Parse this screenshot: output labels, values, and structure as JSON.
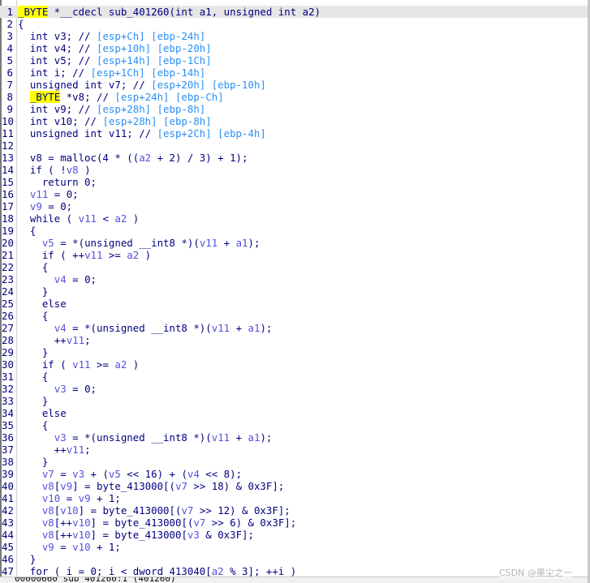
{
  "code_lines": [
    "<span class=\"hl\">_BYTE</span> *__cdecl sub_401260(int a1, unsigned int a2)",
    "{",
    "  int v3; // <span class=\"cm\">[esp+Ch] [ebp-24h]</span>",
    "  int v4; // <span class=\"cm\">[esp+10h] [ebp-20h]</span>",
    "  int v5; // <span class=\"cm\">[esp+14h] [ebp-1Ch]</span>",
    "  int i; // <span class=\"cm\">[esp+1Ch] [ebp-14h]</span>",
    "  unsigned int v7; // <span class=\"cm\">[esp+20h] [ebp-10h]</span>",
    "  <span class=\"hl\">_BYTE</span> *v8; // <span class=\"cm\">[esp+24h] [ebp-Ch]</span>",
    "  int v9; // <span class=\"cm\">[esp+28h] [ebp-8h]</span>",
    "  int v10; // <span class=\"cm\">[esp+28h] [ebp-8h]</span>",
    "  unsigned int v11; // <span class=\"cm\">[esp+2Ch] [ebp-4h]</span>",
    "",
    "  v8 = malloc(4 * ((<span class=\"var\">a2</span> + 2) / 3) + 1);",
    "  if ( !<span class=\"var\">v8</span> )",
    "    return 0;",
    "  <span class=\"var\">v11</span> = 0;",
    "  <span class=\"var\">v9</span> = 0;",
    "  while ( <span class=\"var\">v11</span> &lt; <span class=\"var\">a2</span> )",
    "  {",
    "    <span class=\"var\">v5</span> = *(unsigned __int8 *)(<span class=\"var\">v11</span> + <span class=\"var\">a1</span>);",
    "    if ( ++<span class=\"var\">v11</span> &gt;= <span class=\"var\">a2</span> )",
    "    {",
    "      <span class=\"var\">v4</span> = 0;",
    "    }",
    "    else",
    "    {",
    "      <span class=\"var\">v4</span> = *(unsigned __int8 *)(<span class=\"var\">v11</span> + <span class=\"var\">a1</span>);",
    "      ++<span class=\"var\">v11</span>;",
    "    }",
    "    if ( <span class=\"var\">v11</span> &gt;= <span class=\"var\">a2</span> )",
    "    {",
    "      <span class=\"var\">v3</span> = 0;",
    "    }",
    "    else",
    "    {",
    "      <span class=\"var\">v3</span> = *(unsigned __int8 *)(<span class=\"var\">v11</span> + <span class=\"var\">a1</span>);",
    "      ++<span class=\"var\">v11</span>;",
    "    }",
    "    <span class=\"var\">v7</span> = <span class=\"var\">v3</span> + (<span class=\"var\">v5</span> &lt;&lt; 16) + (<span class=\"var\">v4</span> &lt;&lt; 8);",
    "    <span class=\"var\">v8</span>[<span class=\"var\">v9</span>] = byte_413000[(<span class=\"var\">v7</span> &gt;&gt; 18) &amp; 0x3F];",
    "    <span class=\"var\">v10</span> = <span class=\"var\">v9</span> + 1;",
    "    <span class=\"var\">v8</span>[<span class=\"var\">v10</span>] = byte_413000[(<span class=\"var\">v7</span> &gt;&gt; 12) &amp; 0x3F];",
    "    <span class=\"var\">v8</span>[++<span class=\"var\">v10</span>] = byte_413000[(<span class=\"var\">v7</span> &gt;&gt; 6) &amp; 0x3F];",
    "    <span class=\"var\">v8</span>[++<span class=\"var\">v10</span>] = byte_413000[<span class=\"var\">v3</span> &amp; 0x3F];",
    "    <span class=\"var\">v9</span> = <span class=\"var\">v10</span> + 1;",
    "  }",
    "  for ( i = 0; i &lt; dword_413040[<span class=\"var\">a2</span> % 3]; ++i )"
  ],
  "status_bar": "00000660 sub_401260:1 (401260)",
  "watermark": "CSDN @墨尘之一"
}
